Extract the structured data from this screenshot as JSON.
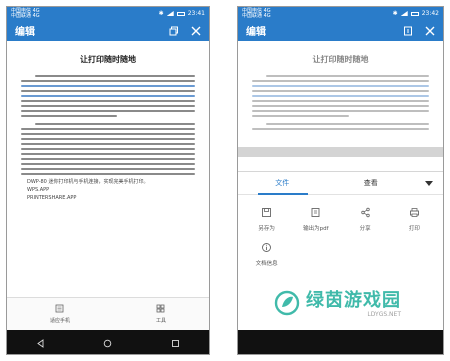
{
  "left": {
    "status": {
      "carrier1": "中国电信 4G",
      "carrier2": "中国联通 4G",
      "time": "23:41"
    },
    "title": "编辑",
    "doc": {
      "heading": "让打印随时随地",
      "tail_lines": [
        "DWP-80 迷你打印机与手机连接，实现完美手机打印。",
        "WPS.APP",
        "PRINTERSHARE.APP"
      ]
    },
    "bottombar": {
      "left_label": "适应手机",
      "right_label": "工具"
    }
  },
  "right": {
    "status": {
      "carrier1": "中国电信 4G",
      "carrier2": "中国联通 4G",
      "time": "23:42"
    },
    "title": "编辑",
    "doc": {
      "heading": "让打印随时随地"
    },
    "sheet": {
      "tabs": [
        "文件",
        "查看"
      ],
      "actions": [
        {
          "label": "另存为",
          "icon": "save-icon"
        },
        {
          "label": "输出为pdf",
          "icon": "pdf-export-icon"
        },
        {
          "label": "分享",
          "icon": "share-icon"
        },
        {
          "label": "打印",
          "icon": "print-icon"
        },
        {
          "label": "文档信息",
          "icon": "info-icon"
        }
      ]
    }
  },
  "watermark": {
    "text": "绿茵游戏园",
    "domain": "LDYGS.NET"
  },
  "colors": {
    "accent": "#2a7cc9",
    "watermark": "#36b7a6",
    "navbar": "#111111"
  }
}
